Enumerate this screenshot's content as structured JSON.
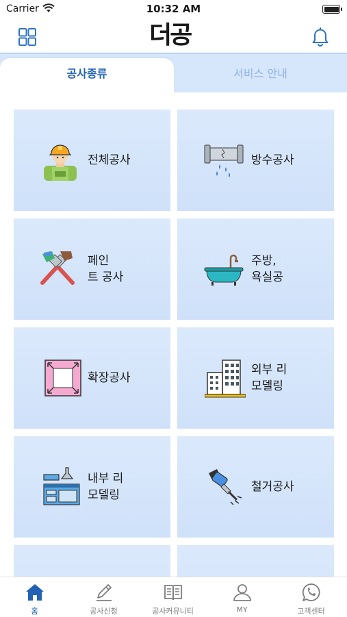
{
  "status_bar": {
    "carrier": "Carrier",
    "time": "10:32 AM"
  },
  "header": {
    "logo_text": "더공",
    "menu_icon": "grid-icon",
    "notification_icon": "bell-icon"
  },
  "tabs": [
    {
      "label": "공사종류",
      "active": true
    },
    {
      "label": "서비스 안내",
      "active": false
    }
  ],
  "categories": [
    {
      "label": "전체공사",
      "icon": "worker-icon"
    },
    {
      "label": "방수공사",
      "icon": "leaking-pipe-icon"
    },
    {
      "label": "페인\n트 공사",
      "icon": "paint-brushes-icon"
    },
    {
      "label": "주방,\n욕실공",
      "icon": "bathtub-icon"
    },
    {
      "label": "확장공사",
      "icon": "expand-frame-icon"
    },
    {
      "label": "외부 리\n모델링",
      "icon": "building-icon"
    },
    {
      "label": "내부 리\n모델링",
      "icon": "kitchen-icon"
    },
    {
      "label": "철거공사",
      "icon": "jackhammer-icon"
    }
  ],
  "bottom_nav": [
    {
      "label": "홈",
      "icon": "home-icon",
      "active": true
    },
    {
      "label": "공사신청",
      "icon": "pencil-icon",
      "active": false
    },
    {
      "label": "공사커뮤니티",
      "icon": "book-icon",
      "active": false
    },
    {
      "label": "MY",
      "icon": "person-icon",
      "active": false
    },
    {
      "label": "고객센터",
      "icon": "whatsapp-icon",
      "active": false
    }
  ],
  "colors": {
    "accent": "#2262b4",
    "card_bg": "#d6e6fb",
    "logo_yellow": "#f5c400"
  }
}
